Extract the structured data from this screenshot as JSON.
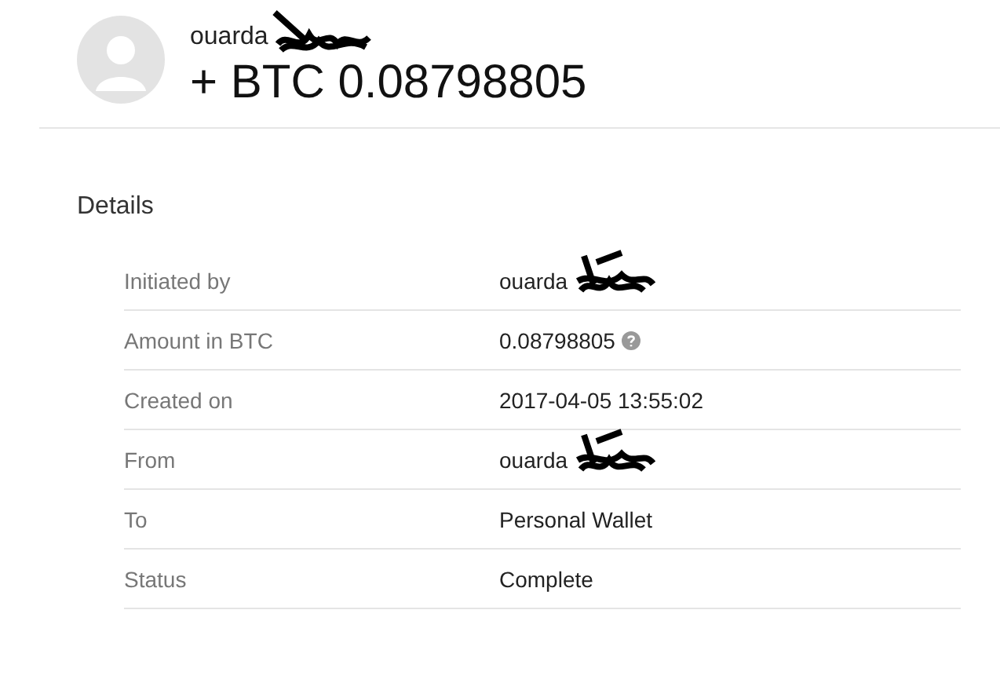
{
  "header": {
    "name": "ouarda",
    "name_redacted": true,
    "amount": "+ BTC 0.08798805"
  },
  "details": {
    "title": "Details",
    "rows": [
      {
        "label": "Initiated by",
        "value": "ouarda",
        "kind": "redacted"
      },
      {
        "label": "Amount in BTC",
        "value": "0.08798805",
        "kind": "help"
      },
      {
        "label": "Created on",
        "value": "2017-04-05 13:55:02",
        "kind": "text"
      },
      {
        "label": "From",
        "value": "ouarda",
        "kind": "redacted"
      },
      {
        "label": "To",
        "value": "Personal Wallet",
        "kind": "text"
      },
      {
        "label": "Status",
        "value": "Complete",
        "kind": "text"
      }
    ]
  }
}
